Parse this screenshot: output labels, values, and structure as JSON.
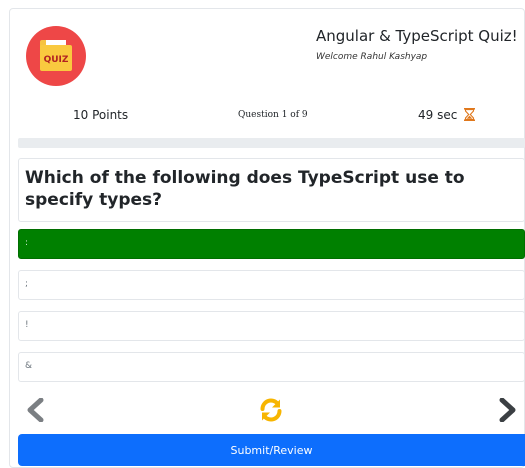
{
  "header": {
    "logo_text": "QUIZ",
    "title": "Angular & TypeScript Quiz!",
    "welcome": "Welcome Rahul Kashyap"
  },
  "stats": {
    "points": "10 Points",
    "question_counter": "Question 1 of 9",
    "timer": "49 sec",
    "timer_icon": "hourglass-icon"
  },
  "progress": {
    "fraction": 0.0
  },
  "question": {
    "text": "Which of the following does TypeScript use to specify types?"
  },
  "options": [
    {
      "label": ":",
      "selected": true
    },
    {
      "label": ";",
      "selected": false
    },
    {
      "label": "!",
      "selected": false
    },
    {
      "label": "&",
      "selected": false
    }
  ],
  "navigation": {
    "prev_icon": "chevron-left-icon",
    "refresh_icon": "refresh-icon",
    "next_icon": "chevron-right-icon",
    "submit_label": "Submit/Review"
  },
  "colors": {
    "selected_option": "#008000",
    "submit_button": "#0d6efd",
    "refresh_icon": "#f7b500",
    "logo_background": "#ee4747",
    "hourglass": "#e0781c"
  }
}
